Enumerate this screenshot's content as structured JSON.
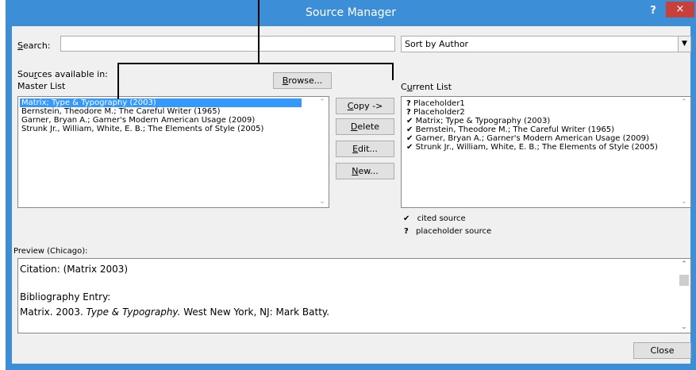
{
  "window": {
    "title": "Source Manager",
    "help": "?",
    "close": "×"
  },
  "search": {
    "label_prefix": "",
    "label_key": "S",
    "label_rest": "earch:",
    "value": "",
    "placeholder": ""
  },
  "sort": {
    "selected": "Sort by Author"
  },
  "sources": {
    "label_line1_a": "Sou",
    "label_line1_key": "r",
    "label_line1_b": "ces available in:",
    "label_line2": "Master List",
    "browse_key": "B",
    "browse_rest": "rowse...",
    "master_list": [
      "Matrix; Type & Typography (2003)",
      "Bernstein, Theodore M.; The Careful Writer (1965)",
      "Garner, Bryan A.; Garner's Modern American Usage (2009)",
      "Strunk Jr., William, White, E. B.; The Elements of Style (2005)"
    ]
  },
  "actions": {
    "copy_key": "C",
    "copy_rest": "opy ->",
    "delete_key": "D",
    "delete_rest": "elete",
    "edit_key": "E",
    "edit_rest": "dit...",
    "new_key": "N",
    "new_rest": "ew..."
  },
  "current": {
    "label_a": "C",
    "label_key": "u",
    "label_b": "rrent List",
    "items": [
      {
        "mark": "?",
        "text": "Placeholder1"
      },
      {
        "mark": "?",
        "text": "Placeholder2"
      },
      {
        "mark": "✔",
        "text": "Matrix; Type & Typography (2003)"
      },
      {
        "mark": "✔",
        "text": "Bernstein, Theodore M.; The Careful Writer (1965)"
      },
      {
        "mark": "✔",
        "text": "Garner, Bryan A.; Garner's Modern American Usage (2009)"
      },
      {
        "mark": "✔",
        "text": "Strunk Jr., William, White, E. B.; The Elements of Style (2005)"
      }
    ]
  },
  "legend": {
    "cited_mark": "✔",
    "cited_text": "cited source",
    "placeholder_mark": "?",
    "placeholder_text": "placeholder source"
  },
  "preview": {
    "label": "Preview (Chicago):",
    "citation": "Citation:  (Matrix 2003)",
    "bib_heading": "Bibliography Entry:",
    "bib_a": "Matrix. 2003. ",
    "bib_title": "Type & Typography.",
    "bib_b": " West New York, NJ: Mark Batty."
  },
  "close_button": "Close"
}
